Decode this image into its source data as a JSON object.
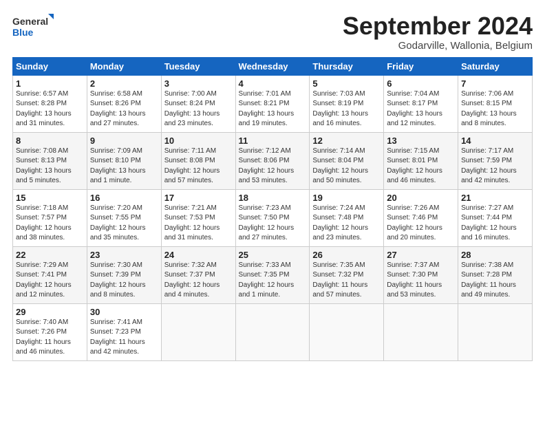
{
  "logo": {
    "general": "General",
    "blue": "Blue"
  },
  "title": "September 2024",
  "location": "Godarville, Wallonia, Belgium",
  "days_of_week": [
    "Sunday",
    "Monday",
    "Tuesday",
    "Wednesday",
    "Thursday",
    "Friday",
    "Saturday"
  ],
  "weeks": [
    [
      {
        "day": "1",
        "sunrise": "6:57 AM",
        "sunset": "8:28 PM",
        "daylight": "13 hours and 31 minutes."
      },
      {
        "day": "2",
        "sunrise": "6:58 AM",
        "sunset": "8:26 PM",
        "daylight": "13 hours and 27 minutes."
      },
      {
        "day": "3",
        "sunrise": "7:00 AM",
        "sunset": "8:24 PM",
        "daylight": "13 hours and 23 minutes."
      },
      {
        "day": "4",
        "sunrise": "7:01 AM",
        "sunset": "8:21 PM",
        "daylight": "13 hours and 19 minutes."
      },
      {
        "day": "5",
        "sunrise": "7:03 AM",
        "sunset": "8:19 PM",
        "daylight": "13 hours and 16 minutes."
      },
      {
        "day": "6",
        "sunrise": "7:04 AM",
        "sunset": "8:17 PM",
        "daylight": "13 hours and 12 minutes."
      },
      {
        "day": "7",
        "sunrise": "7:06 AM",
        "sunset": "8:15 PM",
        "daylight": "13 hours and 8 minutes."
      }
    ],
    [
      {
        "day": "8",
        "sunrise": "7:08 AM",
        "sunset": "8:13 PM",
        "daylight": "13 hours and 5 minutes."
      },
      {
        "day": "9",
        "sunrise": "7:09 AM",
        "sunset": "8:10 PM",
        "daylight": "13 hours and 1 minute."
      },
      {
        "day": "10",
        "sunrise": "7:11 AM",
        "sunset": "8:08 PM",
        "daylight": "12 hours and 57 minutes."
      },
      {
        "day": "11",
        "sunrise": "7:12 AM",
        "sunset": "8:06 PM",
        "daylight": "12 hours and 53 minutes."
      },
      {
        "day": "12",
        "sunrise": "7:14 AM",
        "sunset": "8:04 PM",
        "daylight": "12 hours and 50 minutes."
      },
      {
        "day": "13",
        "sunrise": "7:15 AM",
        "sunset": "8:01 PM",
        "daylight": "12 hours and 46 minutes."
      },
      {
        "day": "14",
        "sunrise": "7:17 AM",
        "sunset": "7:59 PM",
        "daylight": "12 hours and 42 minutes."
      }
    ],
    [
      {
        "day": "15",
        "sunrise": "7:18 AM",
        "sunset": "7:57 PM",
        "daylight": "12 hours and 38 minutes."
      },
      {
        "day": "16",
        "sunrise": "7:20 AM",
        "sunset": "7:55 PM",
        "daylight": "12 hours and 35 minutes."
      },
      {
        "day": "17",
        "sunrise": "7:21 AM",
        "sunset": "7:53 PM",
        "daylight": "12 hours and 31 minutes."
      },
      {
        "day": "18",
        "sunrise": "7:23 AM",
        "sunset": "7:50 PM",
        "daylight": "12 hours and 27 minutes."
      },
      {
        "day": "19",
        "sunrise": "7:24 AM",
        "sunset": "7:48 PM",
        "daylight": "12 hours and 23 minutes."
      },
      {
        "day": "20",
        "sunrise": "7:26 AM",
        "sunset": "7:46 PM",
        "daylight": "12 hours and 20 minutes."
      },
      {
        "day": "21",
        "sunrise": "7:27 AM",
        "sunset": "7:44 PM",
        "daylight": "12 hours and 16 minutes."
      }
    ],
    [
      {
        "day": "22",
        "sunrise": "7:29 AM",
        "sunset": "7:41 PM",
        "daylight": "12 hours and 12 minutes."
      },
      {
        "day": "23",
        "sunrise": "7:30 AM",
        "sunset": "7:39 PM",
        "daylight": "12 hours and 8 minutes."
      },
      {
        "day": "24",
        "sunrise": "7:32 AM",
        "sunset": "7:37 PM",
        "daylight": "12 hours and 4 minutes."
      },
      {
        "day": "25",
        "sunrise": "7:33 AM",
        "sunset": "7:35 PM",
        "daylight": "12 hours and 1 minute."
      },
      {
        "day": "26",
        "sunrise": "7:35 AM",
        "sunset": "7:32 PM",
        "daylight": "11 hours and 57 minutes."
      },
      {
        "day": "27",
        "sunrise": "7:37 AM",
        "sunset": "7:30 PM",
        "daylight": "11 hours and 53 minutes."
      },
      {
        "day": "28",
        "sunrise": "7:38 AM",
        "sunset": "7:28 PM",
        "daylight": "11 hours and 49 minutes."
      }
    ],
    [
      {
        "day": "29",
        "sunrise": "7:40 AM",
        "sunset": "7:26 PM",
        "daylight": "11 hours and 46 minutes."
      },
      {
        "day": "30",
        "sunrise": "7:41 AM",
        "sunset": "7:23 PM",
        "daylight": "11 hours and 42 minutes."
      },
      null,
      null,
      null,
      null,
      null
    ]
  ]
}
